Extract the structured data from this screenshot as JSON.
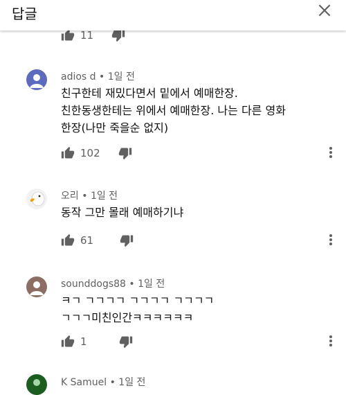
{
  "header": {
    "title": "답글",
    "close_icon": "close-icon"
  },
  "top_row": {
    "likes": "11"
  },
  "comments": [
    {
      "author": "adios d",
      "time": "1일 전",
      "lines": [
        "친구한테 재밌다면서 밑에서 예매한장.",
        "친한동생한테는 위에서 예매한장. 나는 다른 영화",
        "한장(나만 죽을순 없지)"
      ],
      "likes": "102",
      "avatar_color": "#5c6bc0"
    },
    {
      "author": "오리",
      "time": "1일 전",
      "lines": [
        "동작 그만 몰래 예매하기냐"
      ],
      "likes": "61",
      "avatar_color": "#f2f2f2"
    },
    {
      "author": "sounddogs88",
      "time": "1일 전",
      "lines": [
        "ㅋㄱ ㄱㄱㄱㄱ ㄱㄱㄱㄱ ㄱㄱㄱㄱ",
        "ㄱㄱㄱ미친인간ㅋㅋㅋㅋㅋㅋ"
      ],
      "likes": "1",
      "avatar_color": "#8d6e63"
    },
    {
      "author": "K Samuel",
      "time": "1일 전",
      "avatar_color": "#1b5e20"
    }
  ],
  "icons": {
    "like": "thumbs-up-icon",
    "dislike": "thumbs-down-icon",
    "more": "more-vert-icon"
  }
}
